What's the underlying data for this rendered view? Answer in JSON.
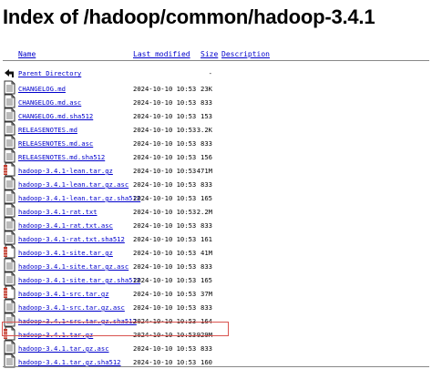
{
  "title": "Index of /hadoop/common/hadoop-3.4.1",
  "headers": {
    "name": "Name",
    "modified": "Last modified",
    "size": "Size",
    "description": "Description"
  },
  "parent": {
    "label": "Parent Directory",
    "size": "-"
  },
  "files": [
    {
      "name": "CHANGELOG.md",
      "modified": "2024-10-10 10:53",
      "size": "23K",
      "icon": "text"
    },
    {
      "name": "CHANGELOG.md.asc",
      "modified": "2024-10-10 10:53",
      "size": "833",
      "icon": "text"
    },
    {
      "name": "CHANGELOG.md.sha512",
      "modified": "2024-10-10 10:53",
      "size": "153",
      "icon": "text"
    },
    {
      "name": "RELEASENOTES.md",
      "modified": "2024-10-10 10:53",
      "size": "3.2K",
      "icon": "text"
    },
    {
      "name": "RELEASENOTES.md.asc",
      "modified": "2024-10-10 10:53",
      "size": "833",
      "icon": "text"
    },
    {
      "name": "RELEASENOTES.md.sha512",
      "modified": "2024-10-10 10:53",
      "size": "156",
      "icon": "text"
    },
    {
      "name": "hadoop-3.4.1-lean.tar.gz",
      "modified": "2024-10-10 10:53",
      "size": "471M",
      "icon": "archive"
    },
    {
      "name": "hadoop-3.4.1-lean.tar.gz.asc",
      "modified": "2024-10-10 10:53",
      "size": "833",
      "icon": "text"
    },
    {
      "name": "hadoop-3.4.1-lean.tar.gz.sha512",
      "modified": "2024-10-10 10:53",
      "size": "165",
      "icon": "text"
    },
    {
      "name": "hadoop-3.4.1-rat.txt",
      "modified": "2024-10-10 10:53",
      "size": "2.2M",
      "icon": "text"
    },
    {
      "name": "hadoop-3.4.1-rat.txt.asc",
      "modified": "2024-10-10 10:53",
      "size": "833",
      "icon": "text"
    },
    {
      "name": "hadoop-3.4.1-rat.txt.sha512",
      "modified": "2024-10-10 10:53",
      "size": "161",
      "icon": "text"
    },
    {
      "name": "hadoop-3.4.1-site.tar.gz",
      "modified": "2024-10-10 10:53",
      "size": "41M",
      "icon": "archive"
    },
    {
      "name": "hadoop-3.4.1-site.tar.gz.asc",
      "modified": "2024-10-10 10:53",
      "size": "833",
      "icon": "text"
    },
    {
      "name": "hadoop-3.4.1-site.tar.gz.sha512",
      "modified": "2024-10-10 10:53",
      "size": "165",
      "icon": "text"
    },
    {
      "name": "hadoop-3.4.1-src.tar.gz",
      "modified": "2024-10-10 10:53",
      "size": "37M",
      "icon": "archive"
    },
    {
      "name": "hadoop-3.4.1-src.tar.gz.asc",
      "modified": "2024-10-10 10:53",
      "size": "833",
      "icon": "text"
    },
    {
      "name": "hadoop-3.4.1-src.tar.gz.sha512",
      "modified": "2024-10-10 10:53",
      "size": "164",
      "icon": "text"
    },
    {
      "name": "hadoop-3.4.1.tar.gz",
      "modified": "2024-10-10 10:53",
      "size": "929M",
      "icon": "archive"
    },
    {
      "name": "hadoop-3.4.1.tar.gz.asc",
      "modified": "2024-10-10 10:53",
      "size": "833",
      "icon": "text"
    },
    {
      "name": "hadoop-3.4.1.tar.gz.sha512",
      "modified": "2024-10-10 10:53",
      "size": "160",
      "icon": "text"
    }
  ],
  "highlight_color": "#d9534f",
  "link_color": "#0000cc"
}
